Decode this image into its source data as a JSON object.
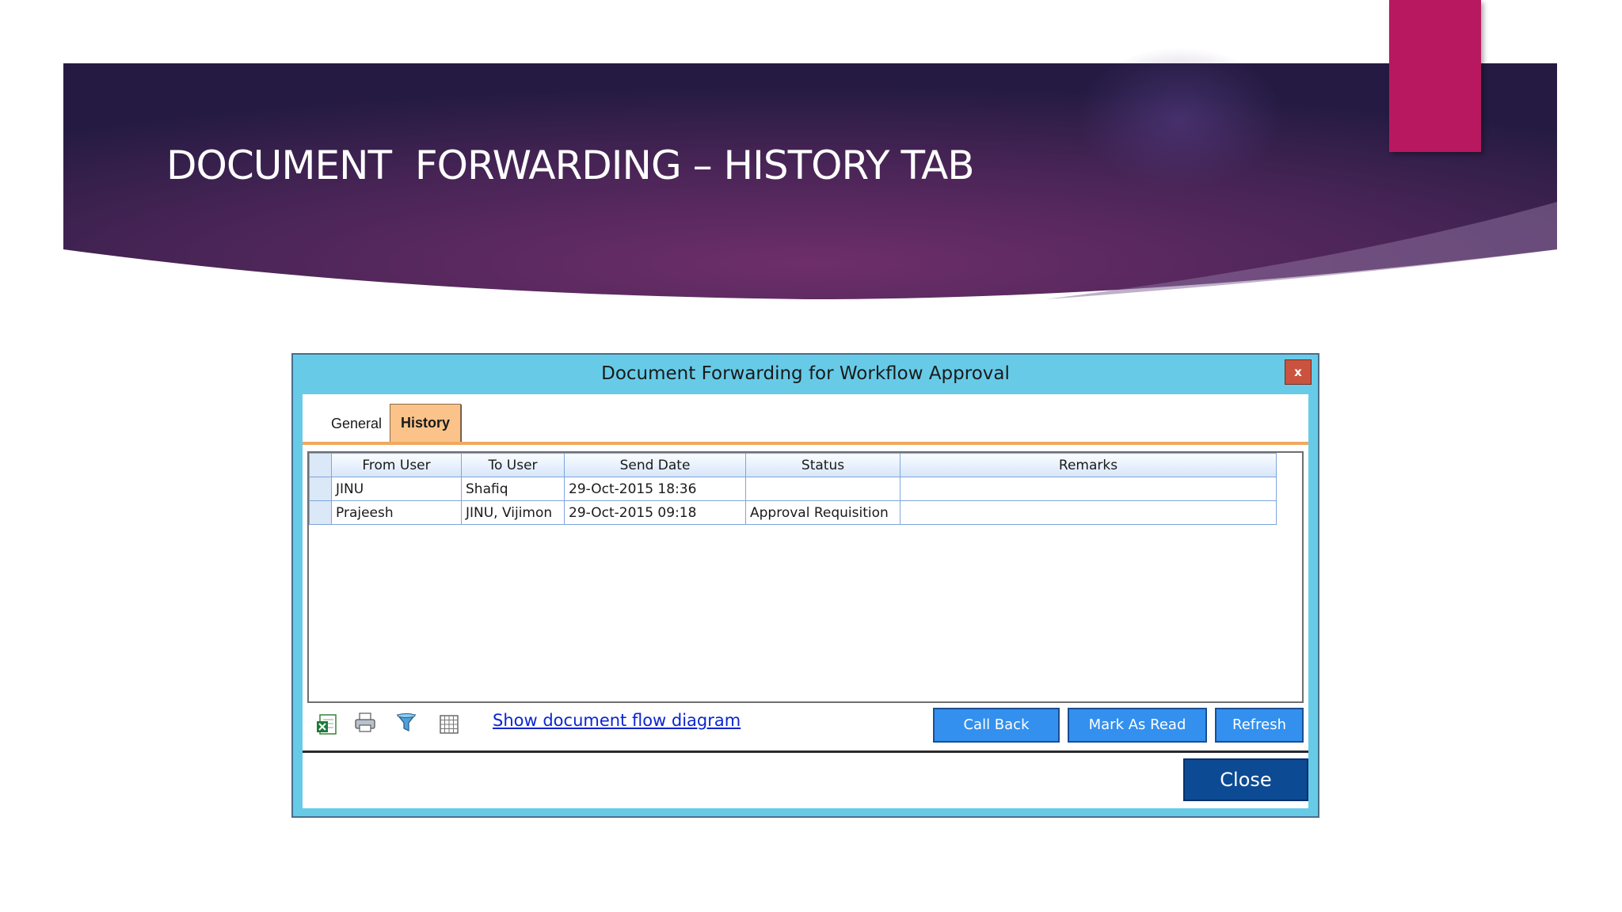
{
  "slide": {
    "title": "DOCUMENT  FORWARDING – HISTORY TAB"
  },
  "dialog": {
    "title": "Document Forwarding for Workflow Approval",
    "close_x": "x",
    "tabs": [
      {
        "label": "General",
        "active": false
      },
      {
        "label": "History",
        "active": true
      }
    ],
    "grid": {
      "columns": [
        "From User",
        "To User",
        "Send Date",
        "Status",
        "Remarks"
      ],
      "rows": [
        {
          "from": "JINU",
          "to": "Shafiq",
          "date": "29-Oct-2015 18:36",
          "status": "",
          "remarks": ""
        },
        {
          "from": "Prajeesh",
          "to": "JINU, Vijimon",
          "date": "29-Oct-2015 09:18",
          "status": "Approval Requisition",
          "remarks": ""
        }
      ]
    },
    "toolbar": {
      "icons": [
        "excel-export-icon",
        "print-icon",
        "filter-icon",
        "grid-icon"
      ],
      "flow_link": "Show document flow diagram"
    },
    "buttons": {
      "call_back": "Call Back",
      "mark_as_read": "Mark As Read",
      "refresh": "Refresh",
      "close": "Close"
    }
  },
  "colors": {
    "banner_dark": "#2c1d49",
    "banner_mid": "#6a2b68",
    "pink_accent": "#b8185f",
    "dialog_frame": "#67cbe8",
    "tab_active": "#fbc38a",
    "button_blue": "#3390ee",
    "close_button": "#0c4a94"
  }
}
